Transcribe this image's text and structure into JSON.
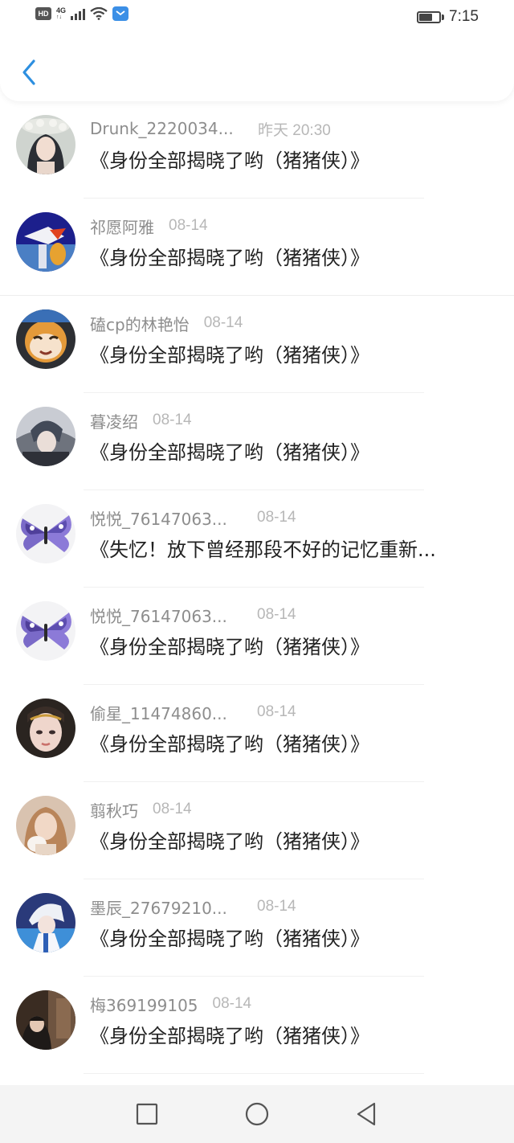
{
  "status_bar": {
    "hd_label": "HD",
    "network_label": "4G",
    "time": "7:15"
  },
  "header": {
    "back_icon": "chevron-left-icon",
    "accent_color": "#2d8fe0"
  },
  "comments": [
    {
      "username": "Drunk_2220034...",
      "time": "昨天 20:30",
      "message": "《身份全部揭晓了哟（猪猪侠）》"
    },
    {
      "username": "祁愿阿雅",
      "time": "08-14",
      "message": "《身份全部揭晓了哟（猪猪侠）》"
    },
    {
      "username": "磕cp的林艳怡",
      "time": "08-14",
      "message": "《身份全部揭晓了哟（猪猪侠）》"
    },
    {
      "username": "暮凌绍",
      "time": "08-14",
      "message": "《身份全部揭晓了哟（猪猪侠）》"
    },
    {
      "username": "悦悦_76147063...",
      "time": "08-14",
      "message": "《失忆！放下曾经那段不好的记忆重新..."
    },
    {
      "username": "悦悦_76147063...",
      "time": "08-14",
      "message": "《身份全部揭晓了哟（猪猪侠）》"
    },
    {
      "username": "偷星_11474860...",
      "time": "08-14",
      "message": "《身份全部揭晓了哟（猪猪侠）》"
    },
    {
      "username": "翦秋巧",
      "time": "08-14",
      "message": "《身份全部揭晓了哟（猪猪侠）》"
    },
    {
      "username": "墨辰_27679210...",
      "time": "08-14",
      "message": "《身份全部揭晓了哟（猪猪侠）》"
    },
    {
      "username": "梅369199105",
      "time": "08-14",
      "message": "《身份全部揭晓了哟（猪猪侠）》"
    }
  ],
  "nav_bar": {
    "recents_icon": "square-icon",
    "home_icon": "circle-icon",
    "back_icon": "triangle-back-icon"
  }
}
